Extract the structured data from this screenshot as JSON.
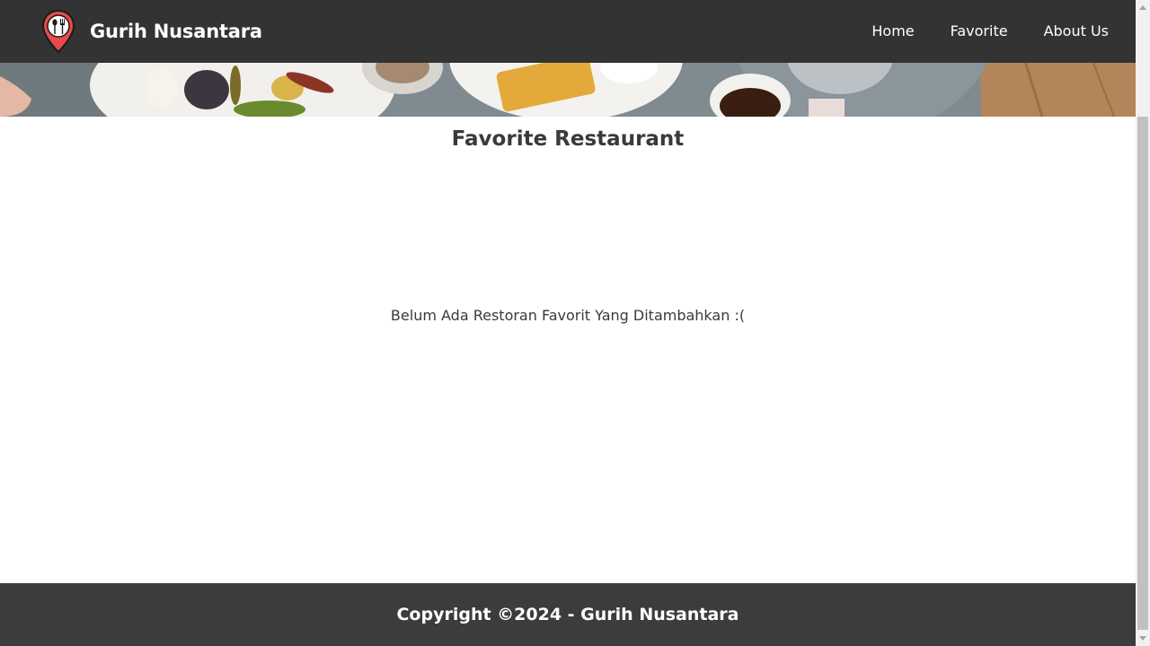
{
  "header": {
    "brand_name": "Gurih Nusantara",
    "logo_icon": "location-pin-cutlery-icon",
    "nav": [
      {
        "label": "Home"
      },
      {
        "label": "Favorite"
      },
      {
        "label": "About Us"
      }
    ]
  },
  "main": {
    "title": "Favorite Restaurant",
    "empty_message": "Belum Ada Restoran Favorit Yang Ditambahkan :("
  },
  "footer": {
    "copyright": "Copyright ©2024 - Gurih Nusantara"
  },
  "colors": {
    "header_bg": "#333333",
    "footer_bg": "#3c3c3c",
    "logo_red": "#e84a4a",
    "text_dark": "#3a3a3a"
  }
}
